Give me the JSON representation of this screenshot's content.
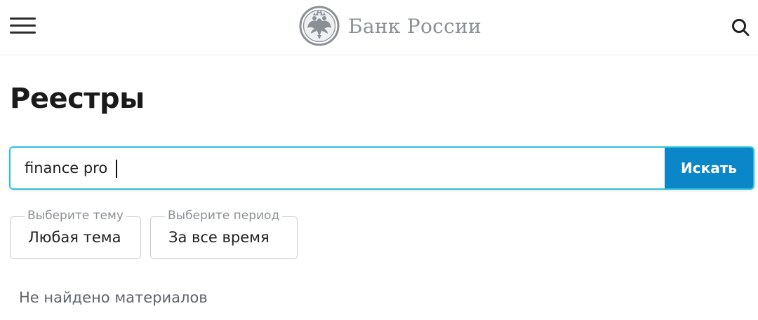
{
  "header": {
    "menu_icon": "hamburger-menu-icon",
    "logo_icon": "double-headed-eagle-emblem-icon",
    "logo_text": "Банк России",
    "search_icon": "search-icon",
    "logo_color": "#8a8f96"
  },
  "main": {
    "title": "Реестры",
    "search": {
      "value": "finance pro",
      "button_label": "Искать",
      "accent_color": "#2ec0dc",
      "button_color": "#0b86c9"
    },
    "filters": [
      {
        "legend": "Выберите тему",
        "value": "Любая тема"
      },
      {
        "legend": "Выберите период",
        "value": "За все время"
      }
    ],
    "status_text": "Не найдено материалов"
  }
}
